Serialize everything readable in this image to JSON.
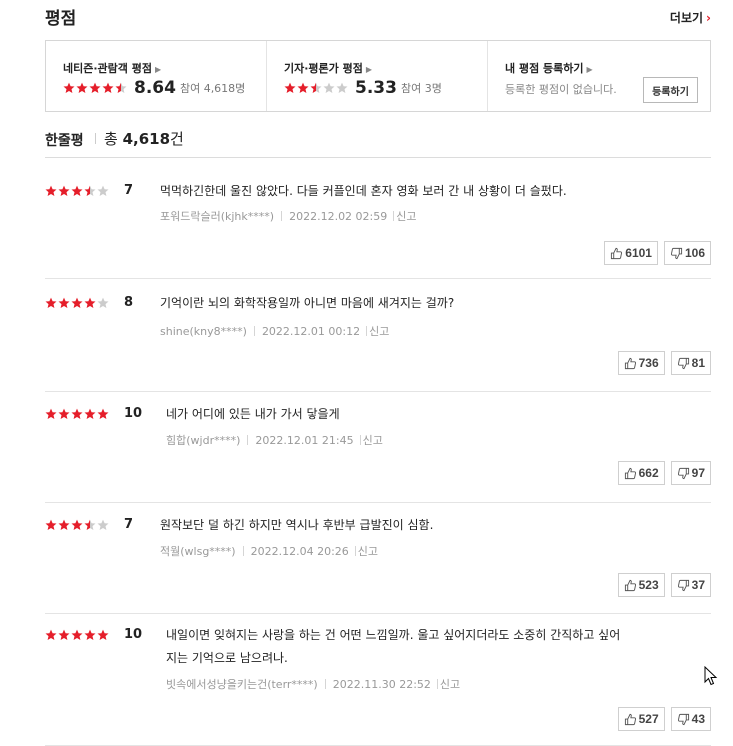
{
  "header": {
    "title": "평점",
    "more_label": "더보기"
  },
  "summary": {
    "netizen": {
      "title": "네티즌·관람객 평점",
      "score": "8.64",
      "participants": "참여 4,618명",
      "stars": 4.5
    },
    "critic": {
      "title": "기자·평론가 평점",
      "score": "5.33",
      "participants": "참여 3명",
      "stars": 2.5
    },
    "mine": {
      "title": "내 평점 등록하기",
      "sub": "등록한 평점이 없습니다.",
      "button": "등록하기"
    }
  },
  "list": {
    "title": "한줄평",
    "total_prefix": "총",
    "total_count": "4,618",
    "total_suffix": "건"
  },
  "colors": {
    "star_on": "#e51e2a",
    "star_off": "#cccccc",
    "accent": "#e51e2a"
  },
  "reviews": [
    {
      "score": "7",
      "stars": 3.5,
      "text_lines": [
        "먹먹하긴한데 울진 않았다. 다들 커플인데 혼자 영화 보러 간 내 상황이 더 슬펐다."
      ],
      "author": "포워드락슬러(kjhk****)",
      "date": "2022.12.02 02:59",
      "report": "신고",
      "likes": "6101",
      "dislikes": "106"
    },
    {
      "score": "8",
      "stars": 4,
      "text_lines": [
        "기억이란 뇌의 화학작용일까 아니면 마음에 새겨지는 걸까?"
      ],
      "author": "shine(kny8****)",
      "date": "2022.12.01 00:12",
      "report": "신고",
      "likes": "736",
      "dislikes": "81"
    },
    {
      "score": "10",
      "stars": 5,
      "text_lines": [
        "네가 어디에 있든 내가 가서 닿을게"
      ],
      "author": "힘합(wjdr****)",
      "date": "2022.12.01 21:45",
      "report": "신고",
      "likes": "662",
      "dislikes": "97"
    },
    {
      "score": "7",
      "stars": 3.5,
      "text_lines": [
        "원작보단 덜 하긴 하지만 역시나 후반부 급발진이 심함."
      ],
      "author": "적월(wlsg****)",
      "date": "2022.12.04 20:26",
      "report": "신고",
      "likes": "523",
      "dislikes": "37"
    },
    {
      "score": "10",
      "stars": 5,
      "text_lines": [
        "내일이면 잊혀지는 사랑을 하는 건 어떤 느낌일까. 울고 싶어지더라도 소중히 간직하고 싶어",
        "지는 기억으로 남으려나."
      ],
      "author": "빗속에서성냥을키는건(terr****)",
      "date": "2022.11.30 22:52",
      "report": "신고",
      "likes": "527",
      "dislikes": "43"
    }
  ]
}
